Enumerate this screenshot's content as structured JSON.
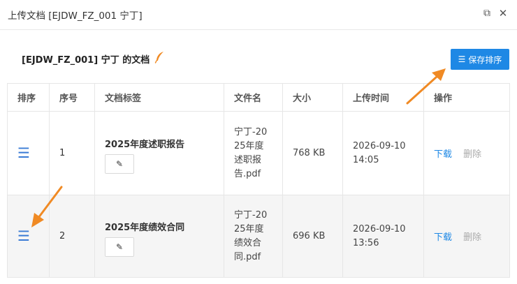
{
  "window": {
    "title": "上传文档 [EJDW_FZ_001 宁丁]",
    "restore_icon": "restore-icon",
    "close_icon": "close-icon",
    "restore_glyph": "⧉",
    "close_glyph": "✕"
  },
  "header": {
    "doc_title": "[EJDW_FZ_001] 宁丁 的文档",
    "save_label": "保存排序",
    "save_icon_glyph": "☰"
  },
  "table": {
    "columns": [
      "排序",
      "序号",
      "文档标签",
      "文件名",
      "大小",
      "上传时间",
      "操作"
    ],
    "rows": [
      {
        "handle": "☰",
        "index": "1",
        "tag": "2025年度述职报告",
        "edit_glyph": "✎",
        "filename": "宁丁-2025年度述职报告.pdf",
        "size": "768 KB",
        "upload_date": "2026-09-10",
        "upload_time": "14:05",
        "download": "下载",
        "delete": "删除"
      },
      {
        "handle": "☰",
        "index": "2",
        "tag": "2025年度绩效合同",
        "edit_glyph": "✎",
        "filename": "宁丁-2025年度绩效合同.pdf",
        "size": "696 KB",
        "upload_date": "2026-09-10",
        "upload_time": "13:56",
        "download": "下载",
        "delete": "删除"
      }
    ]
  },
  "colors": {
    "accent": "#1e88e5",
    "arrow": "#f08a24",
    "feather": "#f08a24"
  }
}
